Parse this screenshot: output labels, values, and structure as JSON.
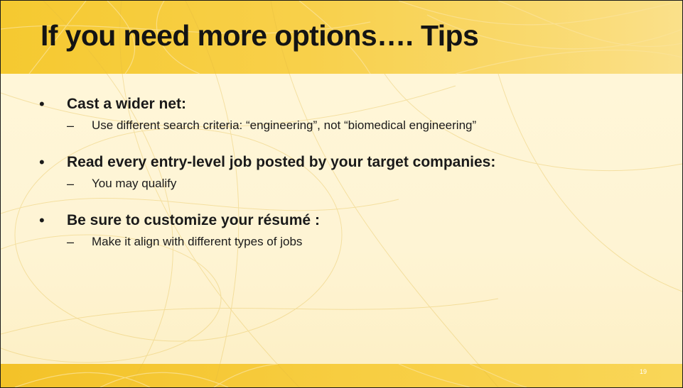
{
  "slide": {
    "title": "If you need more options…. Tips",
    "bullets": [
      {
        "text": "Cast a wider net:",
        "sub": "Use different search criteria: “engineering”, not “biomedical engineering”"
      },
      {
        "text": "Read every entry-level job posted by your target companies:",
        "sub": "You may qualify"
      },
      {
        "text": "Be sure to customize your résumé :",
        "sub": "Make it align with different types of jobs"
      }
    ],
    "bullet_glyph": "•",
    "sub_glyph": "–",
    "page_number": "19"
  },
  "colors": {
    "title_band": "#f5c930",
    "content_background": "#fff6d8",
    "bottom_band": "#f3c228",
    "text": "#1a1a1a"
  }
}
